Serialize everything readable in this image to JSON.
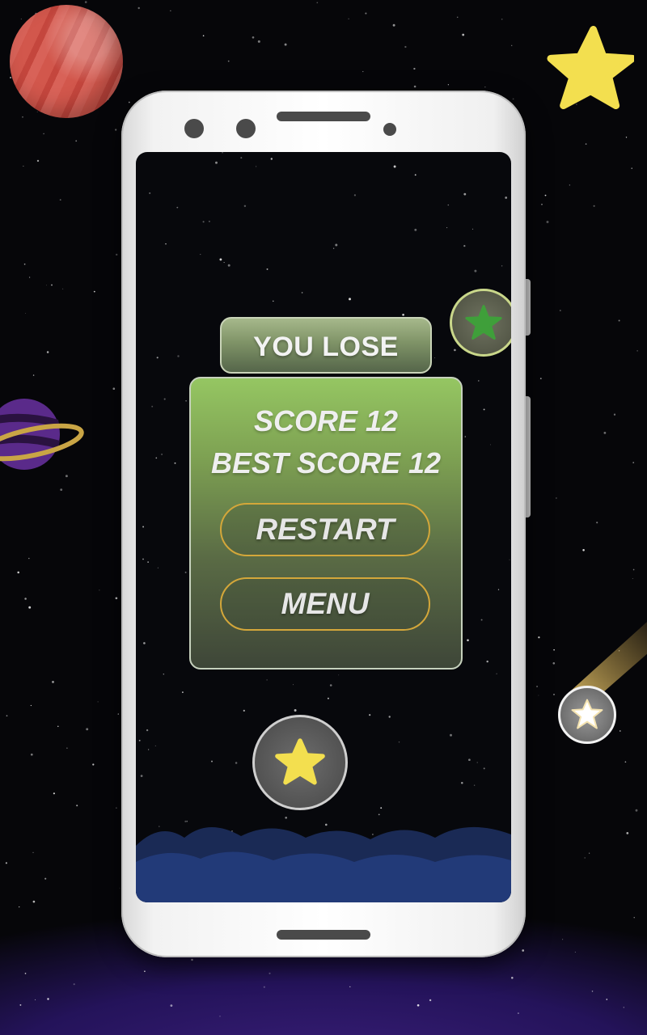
{
  "game": {
    "result_title": "YOU LOSE",
    "score_text": "SCORE 12",
    "best_score_text": "BEST SCORE 12",
    "restart_label": "RESTART",
    "menu_label": "MENU"
  },
  "colors": {
    "panel_top": "#95c662",
    "panel_bottom": "#3e4638",
    "button_border": "#d4a73a",
    "star_yellow": "#f3df4f",
    "star_green": "#3f9f3a",
    "background_purple": "#3a1f7a"
  },
  "icons": {
    "collect_star": "star-icon",
    "green_star": "star-icon",
    "comet_star": "star-icon"
  }
}
